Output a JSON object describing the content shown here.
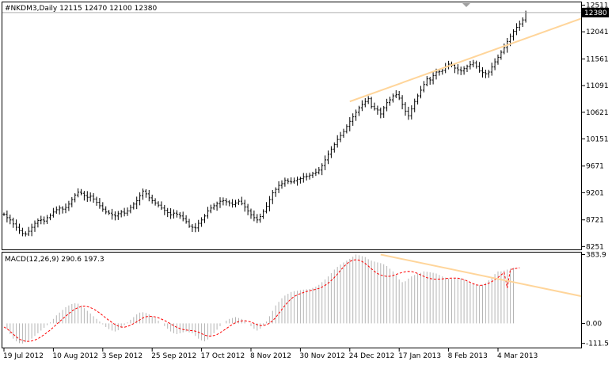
{
  "window": {
    "symbol_line": "#NKDM3,Daily  12115 12470 12100 12380",
    "bid_marker": "12380"
  },
  "colors": {
    "background": "#ffffff",
    "frame": "#000000",
    "candle": "#000000",
    "trendline": "#ffd59a",
    "histogram": "#b4b4b4",
    "signal": "#ff0000",
    "bid_line": "#b0b0b0",
    "bid_badge_bg": "#000000",
    "bid_badge_text": "#ffffff"
  },
  "icons": {
    "scroll_marker": "down-triangle-icon"
  },
  "chart_data": [
    {
      "type": "candlestick",
      "title": "#NKDM3,Daily",
      "ohlc_last": {
        "open": 12115,
        "high": 12470,
        "low": 12100,
        "close": 12380
      },
      "y_ticks": [
        12511,
        12041,
        11561,
        11091,
        10621,
        10151,
        9671,
        9201,
        8721,
        8251
      ],
      "y_tick_labels": [
        "12511",
        "12041",
        "11561",
        "11091",
        "10621",
        "10151",
        "9671",
        "9201",
        "8721",
        "8251"
      ],
      "ylim": [
        8200,
        12560
      ],
      "x_tick_labels": [
        "19 Jul 2012",
        "10 Aug 2012",
        "3 Sep 2012",
        "25 Sep 2012",
        "17 Oct 2012",
        "8 Nov 2012",
        "30 Nov 2012",
        "24 Dec 2012",
        "17 Jan 2013",
        "8 Feb 2013",
        "4 Mar 2013"
      ],
      "x_tick_bar_index": [
        0,
        16,
        32,
        48,
        64,
        80,
        96,
        112,
        128,
        144,
        160
      ],
      "bars": 170,
      "close": [
        8820,
        8760,
        8720,
        8650,
        8590,
        8530,
        8480,
        8470,
        8520,
        8590,
        8660,
        8710,
        8720,
        8700,
        8760,
        8800,
        8860,
        8900,
        8930,
        8910,
        8940,
        9000,
        9080,
        9160,
        9210,
        9190,
        9150,
        9120,
        9140,
        9090,
        9030,
        8970,
        8910,
        8860,
        8840,
        8810,
        8790,
        8830,
        8860,
        8840,
        8880,
        8940,
        9000,
        9060,
        9150,
        9230,
        9180,
        9110,
        9060,
        9020,
        8980,
        8930,
        8890,
        8850,
        8810,
        8840,
        8820,
        8790,
        8740,
        8690,
        8610,
        8590,
        8580,
        8660,
        8720,
        8790,
        8880,
        8930,
        8970,
        9010,
        9050,
        9060,
        9040,
        9020,
        8990,
        9020,
        9050,
        9010,
        8950,
        8880,
        8810,
        8760,
        8720,
        8780,
        8870,
        8960,
        9080,
        9200,
        9260,
        9330,
        9360,
        9420,
        9400,
        9390,
        9410,
        9440,
        9450,
        9480,
        9490,
        9510,
        9540,
        9560,
        9600,
        9680,
        9780,
        9880,
        9970,
        10050,
        10140,
        10210,
        10280,
        10370,
        10460,
        10540,
        10620,
        10700,
        10760,
        10810,
        10860,
        10720,
        10680,
        10660,
        10590,
        10700,
        10790,
        10840,
        10910,
        10930,
        10870,
        10760,
        10640,
        10560,
        10680,
        10810,
        10910,
        11010,
        11110,
        11210,
        11190,
        11270,
        11330,
        11340,
        11360,
        11420,
        11470,
        11450,
        11400,
        11370,
        11350,
        11390,
        11430,
        11460,
        11490,
        11430,
        11350,
        11320,
        11300,
        11330,
        11420,
        11510,
        11590,
        11680,
        11760,
        11870,
        11960,
        12050,
        12120,
        12180,
        12250,
        12380
      ],
      "trendline": {
        "from": {
          "bar": 112,
          "price": 10810
        },
        "to": {
          "bar": 200,
          "price": 12530
        }
      }
    },
    {
      "type": "bar+line",
      "title": "MACD(12,26,9) 290.6 197.3",
      "y_ticks": [
        383.9,
        0.0,
        -111.5
      ],
      "y_tick_labels": [
        "383.9",
        "0.00",
        "-111.5"
      ],
      "ylim": [
        -135,
        395
      ],
      "series": [
        {
          "values": [
            0,
            -30,
            -60,
            -85,
            -100,
            -110,
            -112,
            -105,
            -95,
            -85,
            -70,
            -55,
            -40,
            -25,
            -10,
            5,
            25,
            45,
            60,
            75,
            90,
            100,
            108,
            112,
            110,
            100,
            85,
            70,
            55,
            40,
            25,
            10,
            -5,
            -20,
            -32,
            -40,
            -45,
            -38,
            -25,
            -10,
            5,
            20,
            35,
            50,
            60,
            62,
            58,
            50,
            40,
            30,
            15,
            0,
            -15,
            -30,
            -45,
            -55,
            -60,
            -55,
            -50,
            -45,
            -50,
            -55,
            -70,
            -85,
            -95,
            -100,
            -90,
            -75,
            -55,
            -35,
            -15,
            0,
            15,
            25,
            30,
            35,
            30,
            25,
            15,
            0,
            -15,
            -30,
            -40,
            -30,
            -10,
            10,
            40,
            70,
            100,
            120,
            140,
            155,
            165,
            175,
            180,
            182,
            185,
            188,
            190,
            192,
            198,
            205,
            215,
            230,
            245,
            262,
            280,
            300,
            315,
            328,
            340,
            350,
            360,
            372,
            383.9,
            380,
            375,
            370,
            358,
            350,
            345,
            340,
            336,
            330,
            320,
            305,
            290,
            270,
            245,
            230,
            235,
            250,
            262,
            270,
            278,
            282,
            290,
            288,
            285,
            282,
            278,
            270,
            262,
            255,
            250,
            248,
            250,
            255,
            252,
            245,
            235,
            225,
            220,
            215,
            212,
            215,
            225,
            240,
            258,
            275,
            290,
            290.6,
            295,
            300,
            305,
            310
          ]
        },
        {
          "values": [
            -20,
            -30,
            -45,
            -60,
            -75,
            -88,
            -95,
            -100,
            -100,
            -98,
            -93,
            -85,
            -75,
            -63,
            -50,
            -37,
            -22,
            -6,
            10,
            25,
            40,
            55,
            68,
            80,
            88,
            94,
            96,
            94,
            88,
            80,
            70,
            58,
            44,
            30,
            17,
            5,
            -7,
            -15,
            -20,
            -21,
            -17,
            -10,
            -1,
            9,
            20,
            30,
            37,
            40,
            39,
            36,
            31,
            24,
            16,
            7,
            -3,
            -13,
            -22,
            -29,
            -34,
            -37,
            -39,
            -40,
            -43,
            -49,
            -57,
            -65,
            -70,
            -71,
            -68,
            -62,
            -52,
            -41,
            -29,
            -17,
            -6,
            4,
            10,
            14,
            15,
            12,
            7,
            0,
            -7,
            -12,
            -12,
            -8,
            1,
            15,
            33,
            55,
            78,
            100,
            120,
            137,
            150,
            159,
            166,
            172,
            178,
            182,
            186,
            190,
            195,
            202,
            212,
            224,
            239,
            256,
            275,
            296,
            315,
            332,
            345,
            353,
            355,
            353,
            345,
            334,
            320,
            305,
            290,
            278,
            270,
            265,
            262,
            263,
            267,
            273,
            279,
            284,
            288,
            290,
            289,
            285,
            278,
            270,
            262,
            255,
            250,
            247,
            246,
            247,
            248,
            250,
            252,
            253,
            253,
            252,
            249,
            244,
            237,
            229,
            221,
            215,
            212,
            213,
            217,
            224,
            233,
            244,
            256,
            270,
            284,
            197.3,
            300,
            304,
            307,
            310
          ]
        }
      ],
      "trendline": {
        "from": {
          "bar": 122,
          "value": 383.9
        },
        "to": {
          "bar": 200,
          "value": 105
        }
      }
    }
  ]
}
